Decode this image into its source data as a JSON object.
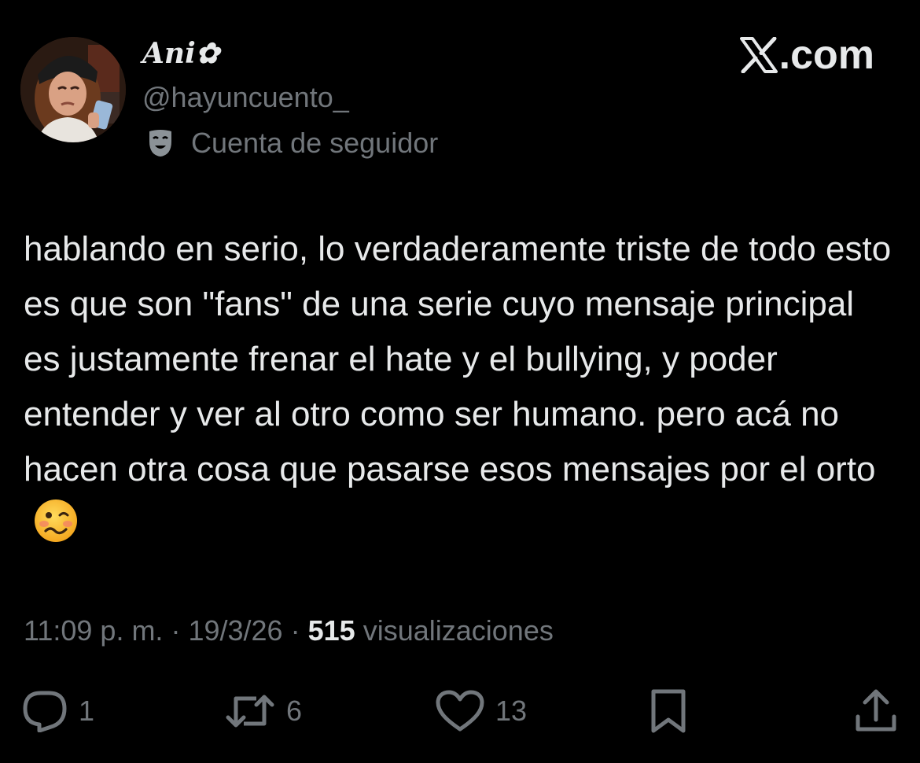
{
  "brand": {
    "text": ".com",
    "logo": "x-logo-icon"
  },
  "author": {
    "display_name": "Ani✿",
    "handle": "@hayuncuento_",
    "badge_label": "Cuenta de seguidor",
    "badge_icon": "theater-mask-icon"
  },
  "tweet": {
    "text": "hablando en serio, lo verdaderamente triste de todo esto es que son \"fans\" de una serie cuyo mensaje principal es justamente frenar el hate y el bullying, y poder entender y ver al otro como ser humano. pero acá no hacen otra cosa que pasarse esos mensajes por el orto",
    "emoji": "woozy-face-emoji"
  },
  "meta": {
    "time": "11:09 p. m.",
    "separator": "·",
    "date": "19/3/26",
    "views_count": "515",
    "views_label": "visualizaciones"
  },
  "actions": {
    "reply_count": "1",
    "retweet_count": "6",
    "like_count": "13"
  },
  "colors": {
    "background": "#000000",
    "primary_text": "#e7e9ea",
    "secondary_text": "#71767b"
  }
}
